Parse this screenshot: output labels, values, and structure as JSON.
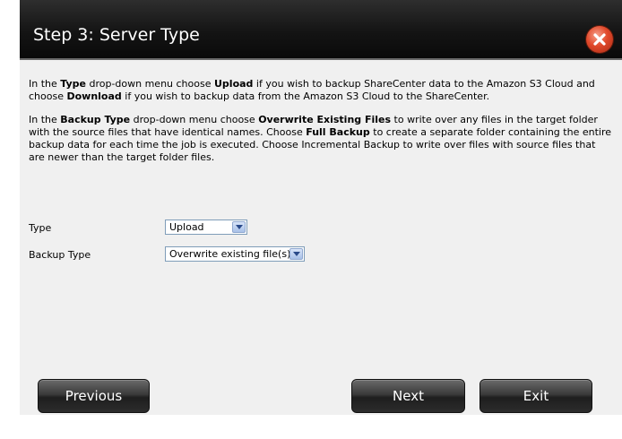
{
  "dialog": {
    "title": "Step 3: Server Type",
    "close_icon": "close-icon"
  },
  "instructions": {
    "p1": [
      {
        "t": "In the ",
        "b": false
      },
      {
        "t": "Type",
        "b": true
      },
      {
        "t": " drop-down menu choose ",
        "b": false
      },
      {
        "t": "Upload",
        "b": true
      },
      {
        "t": " if you wish to backup ShareCenter data to the Amazon S3 Cloud and choose ",
        "b": false
      },
      {
        "t": "Download",
        "b": true
      },
      {
        "t": " if you wish to backup data from the Amazon S3 Cloud to the ShareCenter.",
        "b": false
      }
    ],
    "p2": [
      {
        "t": "In the ",
        "b": false
      },
      {
        "t": "Backup Type",
        "b": true
      },
      {
        "t": " drop-down menu choose ",
        "b": false
      },
      {
        "t": "Overwrite Existing Files",
        "b": true
      },
      {
        "t": " to write over any files in the target folder with the source files that have identical names. Choose ",
        "b": false
      },
      {
        "t": "Full Backup",
        "b": true
      },
      {
        "t": " to create a separate folder containing the entire backup data for each time the job is executed. Choose Incremental Backup to write over files with source files that are newer than the target folder files.",
        "b": false
      }
    ]
  },
  "form": {
    "type_label": "Type",
    "type_value": "Upload",
    "backup_type_label": "Backup Type",
    "backup_type_value": "Overwrite existing file(s)"
  },
  "buttons": {
    "previous": "Previous",
    "next": "Next",
    "exit": "Exit"
  }
}
